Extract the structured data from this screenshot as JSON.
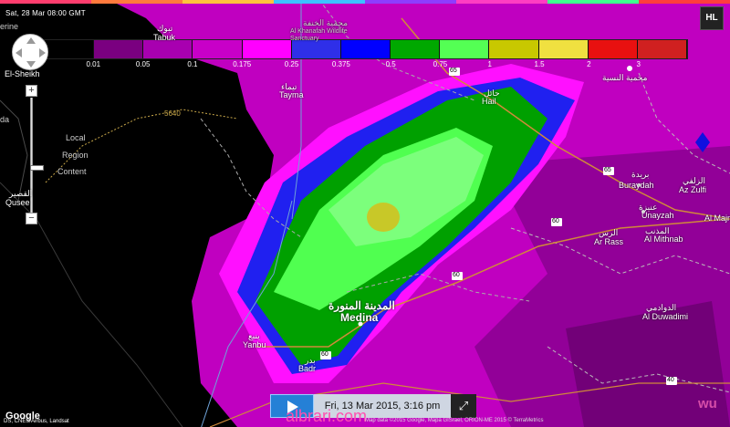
{
  "timestamp": "Sat, 28 Mar 08:00 GMT",
  "legend": {
    "colors": [
      "#000000",
      "#7a0080",
      "#a800b0",
      "#c800c8",
      "#ff00ff",
      "#2f2fe8",
      "#0000ff",
      "#00a800",
      "#54ff54",
      "#c8c800",
      "#f0e040",
      "#e81010",
      "#d02020"
    ],
    "labels": [
      "0.01",
      "0.05",
      "0.1",
      "0.175",
      "0.25",
      "0.375",
      "0.5",
      "0.75",
      "1",
      "1.5",
      "2",
      "3"
    ]
  },
  "places": {
    "tabuk": {
      "ar": "تبوك",
      "en": "Tabuk"
    },
    "tayma": {
      "ar": "تيماء",
      "en": "Tayma"
    },
    "hail": {
      "ar": "حائل",
      "en": "Hail"
    },
    "buraydah": {
      "ar": "بريدة",
      "en": "Buraydah"
    },
    "unayzah": {
      "ar": "عنيزة",
      "en": "Unayzah"
    },
    "ar_rass": {
      "ar": "الرس",
      "en": "Ar Rass"
    },
    "al_mithnab": {
      "ar": "المذنب",
      "en": "Al Mithnab"
    },
    "az_zulfi": {
      "ar": "الزلفي",
      "en": "Az Zulfi"
    },
    "al_majm": {
      "ar": "",
      "en": "Al Majm"
    },
    "medina": {
      "ar": "المدينة المنورة",
      "en": "Medina"
    },
    "yanbu": {
      "ar": "ينبع",
      "en": "Yanbu"
    },
    "badr": {
      "ar": "بدر",
      "en": "Badr"
    },
    "al_duwadimi": {
      "ar": "الدوادمي",
      "en": "Al Duwadimi"
    },
    "qusee": {
      "ar": "القصير",
      "en": "Qusee"
    },
    "el_sheikh": {
      "ar": "",
      "en": "El-Sheikh"
    },
    "khanafah_ar": "محمية الخنفة",
    "khanafah_en": "Al Khanafah Wildlife Sanctuary",
    "nasiya": "محمية النسية",
    "local1": "Local",
    "local2": "Region",
    "local3": "Content",
    "border_num": "5640",
    "edge_left1": "erine",
    "edge_left2": "da"
  },
  "roads": [
    "65",
    "65",
    "60",
    "60",
    "60",
    "40"
  ],
  "player": {
    "date_label": "Fri, 13 Mar 2015, 3:16 pm"
  },
  "controls": {
    "hl_label": "HL",
    "zoom_in": "+",
    "zoom_out": "−"
  },
  "attribution": "Map data ©2015 Google, Mapa GISrael, ORION-ME 2015 © TerraMetrics",
  "google": "Google",
  "google_sub": "DS, CNES/Airbus, Landsat",
  "watermark": "albrari.com",
  "brand": "wu"
}
